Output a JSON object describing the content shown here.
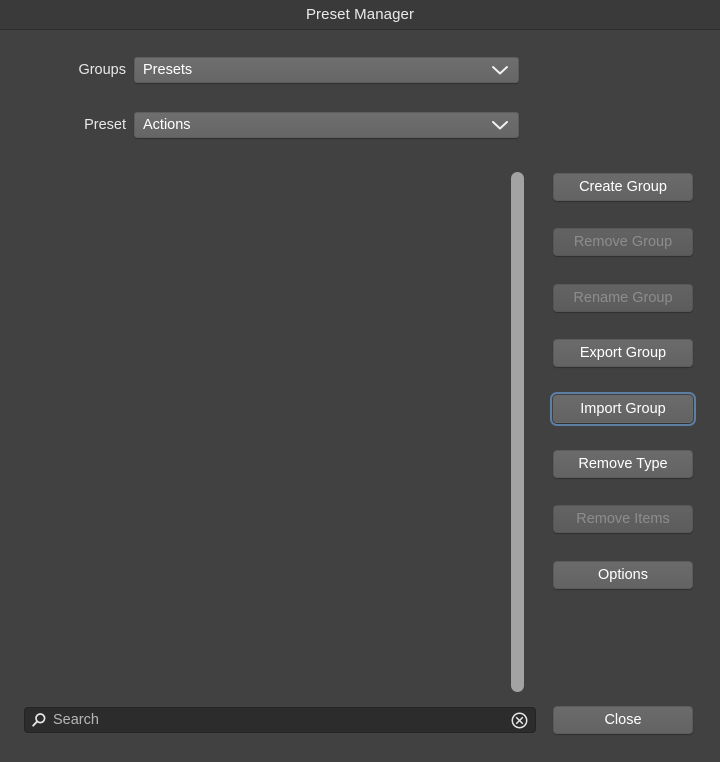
{
  "window": {
    "title": "Preset Manager"
  },
  "form": {
    "groups": {
      "label": "Groups",
      "value": "Presets",
      "chevron_icon": "chevron-down-icon"
    },
    "preset": {
      "label": "Preset",
      "value": "Actions",
      "chevron_icon": "chevron-down-icon"
    }
  },
  "list": {
    "items": [],
    "scrollbar_visible": true
  },
  "buttons": [
    {
      "label": "Create Group",
      "name": "create-group-button",
      "enabled": true,
      "focused": false
    },
    {
      "label": "Remove Group",
      "name": "remove-group-button",
      "enabled": false,
      "focused": false
    },
    {
      "label": "Rename Group",
      "name": "rename-group-button",
      "enabled": false,
      "focused": false
    },
    {
      "label": "Export Group",
      "name": "export-group-button",
      "enabled": true,
      "focused": false
    },
    {
      "label": "Import Group",
      "name": "import-group-button",
      "enabled": true,
      "focused": true
    },
    {
      "label": "Remove Type",
      "name": "remove-type-button",
      "enabled": true,
      "focused": false
    },
    {
      "label": "Remove Items",
      "name": "remove-items-button",
      "enabled": false,
      "focused": false
    },
    {
      "label": "Options",
      "name": "options-button",
      "enabled": true,
      "focused": false
    }
  ],
  "search": {
    "value": "",
    "placeholder": "Search",
    "search_icon": "search-icon",
    "clear_icon": "clear-circle-icon"
  },
  "footer": {
    "close_label": "Close"
  },
  "colors": {
    "window_background": "#414141",
    "titlebar_background": "#3a3a3a",
    "control_face": "#6b6b6b",
    "control_text": "#ffffff",
    "disabled_text": "#8d8d8d",
    "focus_ring": "#5d7fa4",
    "scrollbar_thumb": "#a3a3a3",
    "search_background": "#2c2c2c",
    "placeholder_text": "#b6b6b6"
  }
}
